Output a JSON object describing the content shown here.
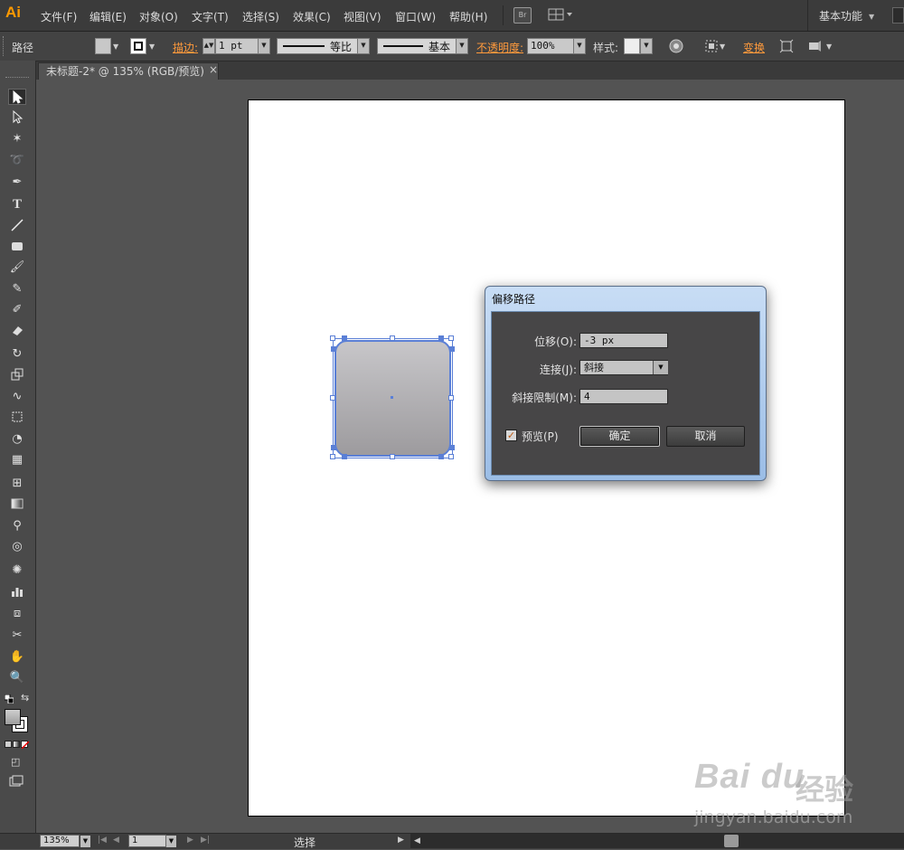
{
  "app": {
    "logo": "Ai",
    "workspace": "基本功能"
  },
  "menu": [
    "文件(F)",
    "编辑(E)",
    "对象(O)",
    "文字(T)",
    "选择(S)",
    "效果(C)",
    "视图(V)",
    "窗口(W)",
    "帮助(H)"
  ],
  "menubar_icons": {
    "bridge": "Br"
  },
  "control": {
    "selection_type": "路径",
    "stroke_label": "描边:",
    "stroke_weight": "1 pt",
    "profile_label": "等比",
    "brush_label": "基本",
    "opacity_label": "不透明度:",
    "opacity_value": "100%",
    "style_label": "样式:",
    "transform_label": "变换"
  },
  "document_tab": {
    "title": "未标题-2* @ 135% (RGB/预览)",
    "close": "×"
  },
  "dialog": {
    "title": "偏移路径",
    "offset_label": "位移(O):",
    "offset_value": "-3 px",
    "joins_label": "连接(J):",
    "joins_value": "斜接",
    "miter_label": "斜接限制(M):",
    "miter_value": "4",
    "preview_label": "预览(P)",
    "preview_checked": "✓",
    "ok": "确定",
    "cancel": "取消"
  },
  "status": {
    "zoom": "135%",
    "page": "1",
    "tool": "选择"
  },
  "watermark": {
    "logo": "Bai du",
    "cn": "经验",
    "url": "jingyan.baidu.com"
  },
  "colors": {
    "accent": "#ff9a3c",
    "selection": "#5a7fd6",
    "dialog_frame": "#9bbde6"
  }
}
